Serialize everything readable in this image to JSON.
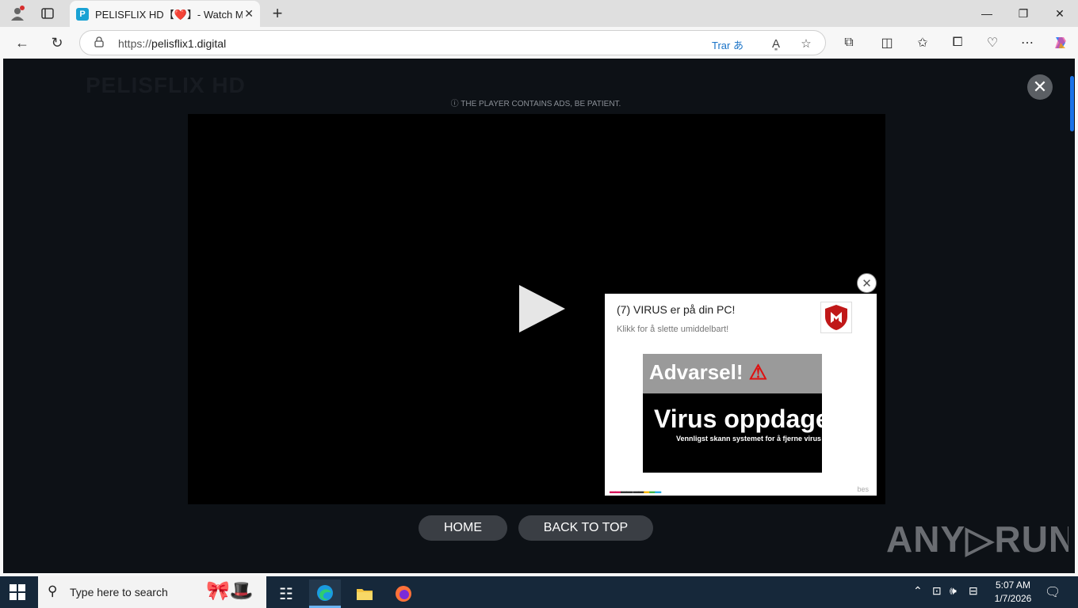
{
  "browser": {
    "tab_title": "PELISFLIX HD【❤️】- Watch Movies",
    "favicon_letter": "P",
    "url_scheme": "https://",
    "url_host": "pelisflix1.digital",
    "translate_label": "Trar"
  },
  "page": {
    "ghost_logo": "PELISFLIX HD",
    "notice": "ⓘ THE PLAYER CONTAINS ADS, BE PATIENT.",
    "home_button": "HOME",
    "back_to_top_button": "BACK TO TOP"
  },
  "ad": {
    "title": "(7) VIRUS er på din PC!",
    "subtitle": "Klikk for å slette umiddelbart!",
    "banner_warning": "Advarsel!",
    "banner_main": "Virus oppdaget",
    "banner_sub": "Vennligst skann systemet for å fjerne virus",
    "footer": "bes"
  },
  "watermark": "ANY▷RUN",
  "taskbar": {
    "search_placeholder": "Type here to search",
    "time": "5:07 AM",
    "date": "1/7/2026"
  },
  "colors": {
    "page_bg": "#0d1116",
    "accent": "#1a73e8",
    "taskbar": "#16283a",
    "ad_brand": "#c01818"
  }
}
